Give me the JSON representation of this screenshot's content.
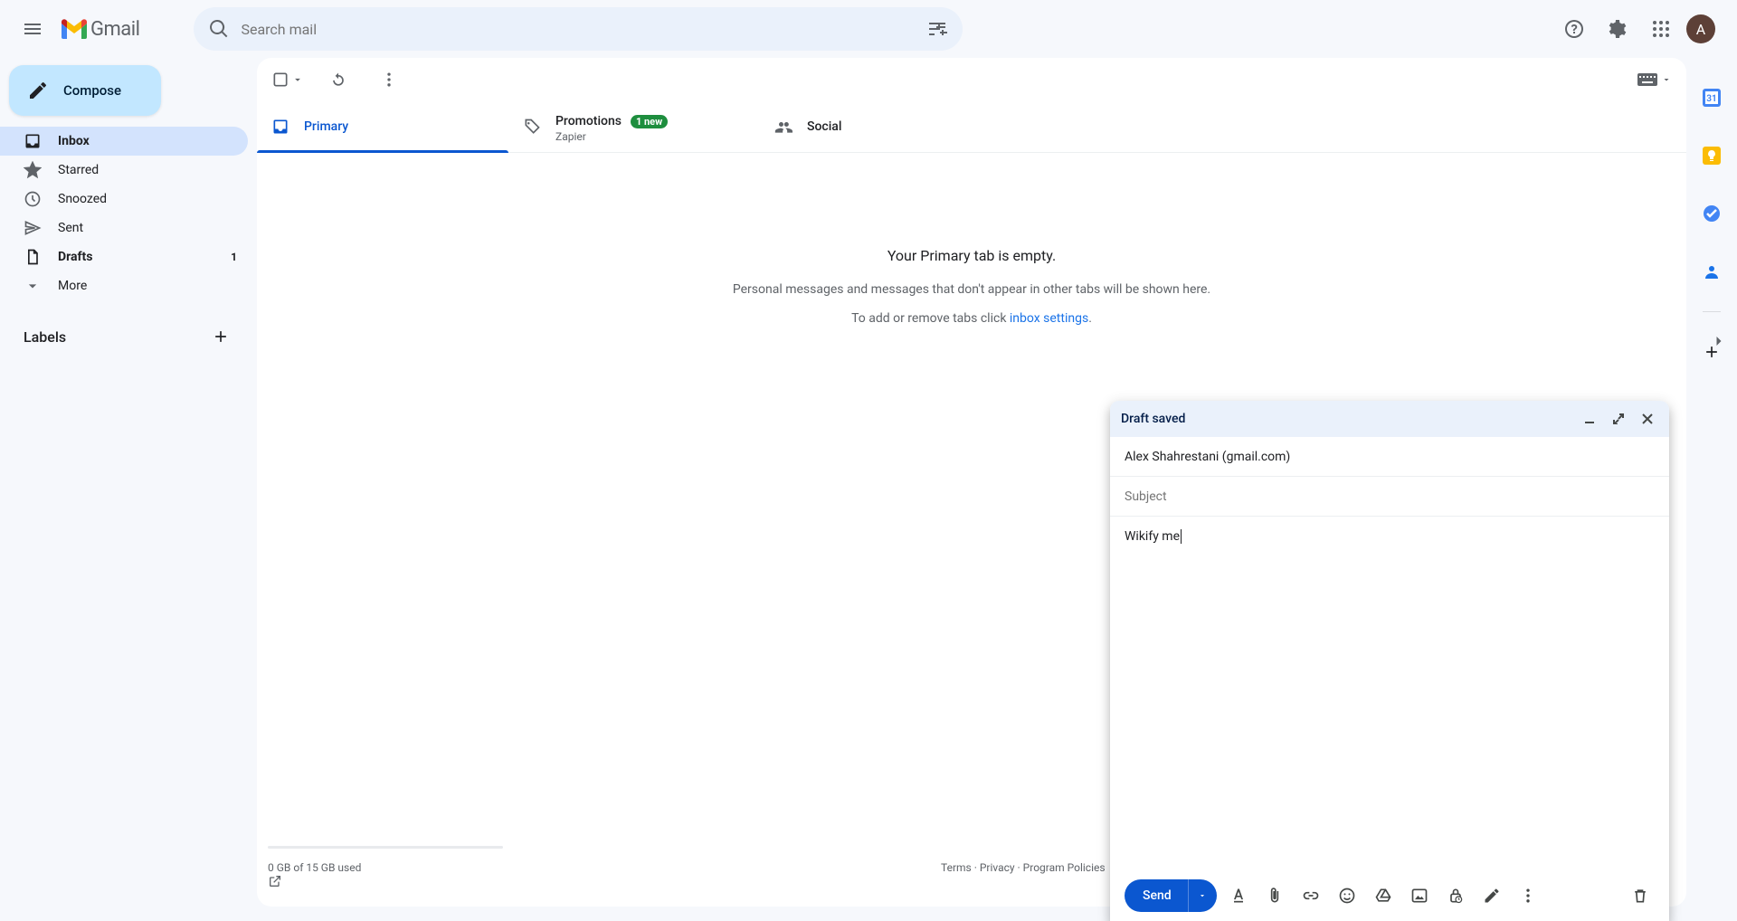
{
  "header": {
    "logo_text": "Gmail",
    "search_placeholder": "Search mail",
    "avatar_letter": "A"
  },
  "sidebar": {
    "compose_label": "Compose",
    "items": [
      {
        "label": "Inbox",
        "count": ""
      },
      {
        "label": "Starred",
        "count": ""
      },
      {
        "label": "Snoozed",
        "count": ""
      },
      {
        "label": "Sent",
        "count": ""
      },
      {
        "label": "Drafts",
        "count": "1"
      },
      {
        "label": "More",
        "count": ""
      }
    ],
    "labels_header": "Labels"
  },
  "tabs": {
    "primary": {
      "label": "Primary"
    },
    "promotions": {
      "label": "Promotions",
      "badge": "1 new",
      "sub": "Zapier"
    },
    "social": {
      "label": "Social"
    }
  },
  "empty": {
    "heading": "Your Primary tab is empty.",
    "line1_full": "Personal messages and messages that don't appear in other tabs will be shown here.",
    "line2_prefix": "To add or remove tabs click ",
    "line2_link": "inbox settings",
    "line2_suffix": "."
  },
  "footer": {
    "storage": "0 GB of 15 GB used",
    "links": "Terms · Privacy · Program Policies"
  },
  "compose": {
    "header_title": "Draft saved",
    "to_value": "Alex Shahrestani (gmail.com)",
    "subject_placeholder": "Subject",
    "body_text": "Wikify me",
    "send_label": "Send"
  }
}
